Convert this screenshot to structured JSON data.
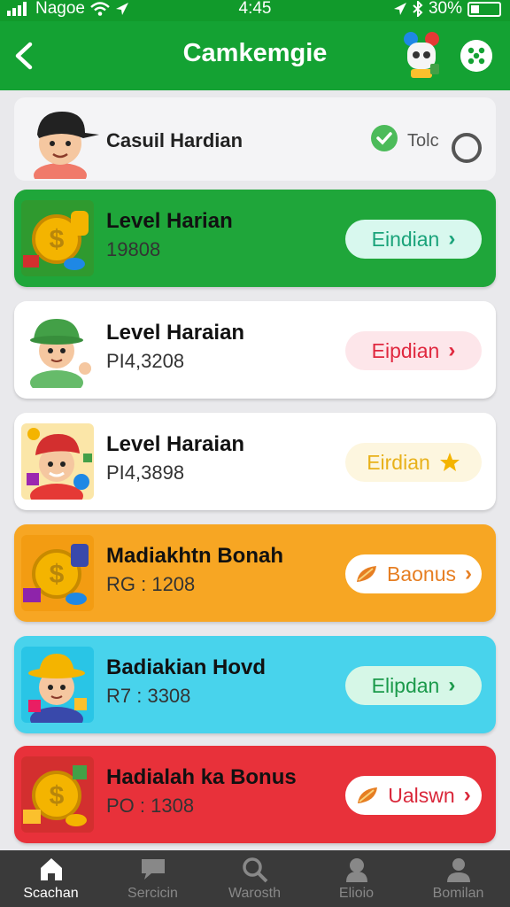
{
  "status_bar": {
    "carrier": "Nagoe",
    "time": "4:45",
    "battery": "30%",
    "battery_level": 0.3
  },
  "app_bar": {
    "title": "Camkemgie"
  },
  "user": {
    "name": "Casuil Hardian",
    "toggle_label": "Tolc"
  },
  "rewards": [
    {
      "title": "Level Harian",
      "subtitle": "19808",
      "button": "Eindian",
      "bg": "#1fa63a",
      "btn_bg": "#d8f8ee",
      "btn_color": "#1aa37a",
      "btn_icon": "chevron-right"
    },
    {
      "title": "Level Haraian",
      "subtitle": "PI4,3208",
      "button": "Eipdian",
      "bg": "#ffffff",
      "btn_bg": "#fde6ea",
      "btn_color": "#e0283f",
      "btn_icon": "chevron-right"
    },
    {
      "title": "Level Haraian",
      "subtitle": "PI4,3898",
      "button": "Eirdian",
      "bg": "#ffffff",
      "btn_bg": "#fdf6df",
      "btn_color": "#e8b11a",
      "btn_icon": "star"
    },
    {
      "title": "Madiakhtn Bonah",
      "subtitle": "RG : 1208",
      "button": "Baonus",
      "bg": "#f7a623",
      "btn_bg": "#ffffff",
      "btn_color": "#e67e22",
      "btn_icon": "chevron-right"
    },
    {
      "title": "Badiakian Hovd",
      "subtitle": "R7 : 3308",
      "button": "Elipdan",
      "bg": "#48d3ec",
      "btn_bg": "#d6f7e7",
      "btn_color": "#1b9a4b",
      "btn_icon": "chevron-right"
    },
    {
      "title": "Hadialah ka Bonus",
      "subtitle": "PO : 1308",
      "button": "Ualswn",
      "bg": "#e8313a",
      "btn_bg": "#ffffff",
      "btn_color": "#d9273a",
      "btn_icon": "chevron-right"
    }
  ],
  "nav": [
    {
      "label": "Scachan",
      "icon": "home-icon",
      "active": true
    },
    {
      "label": "Sercicin",
      "icon": "chat-icon",
      "active": false
    },
    {
      "label": "Warosth",
      "icon": "search-icon",
      "active": false
    },
    {
      "label": "Elioio",
      "icon": "group-icon",
      "active": false
    },
    {
      "label": "Bomilan",
      "icon": "profile-icon",
      "active": false
    }
  ]
}
